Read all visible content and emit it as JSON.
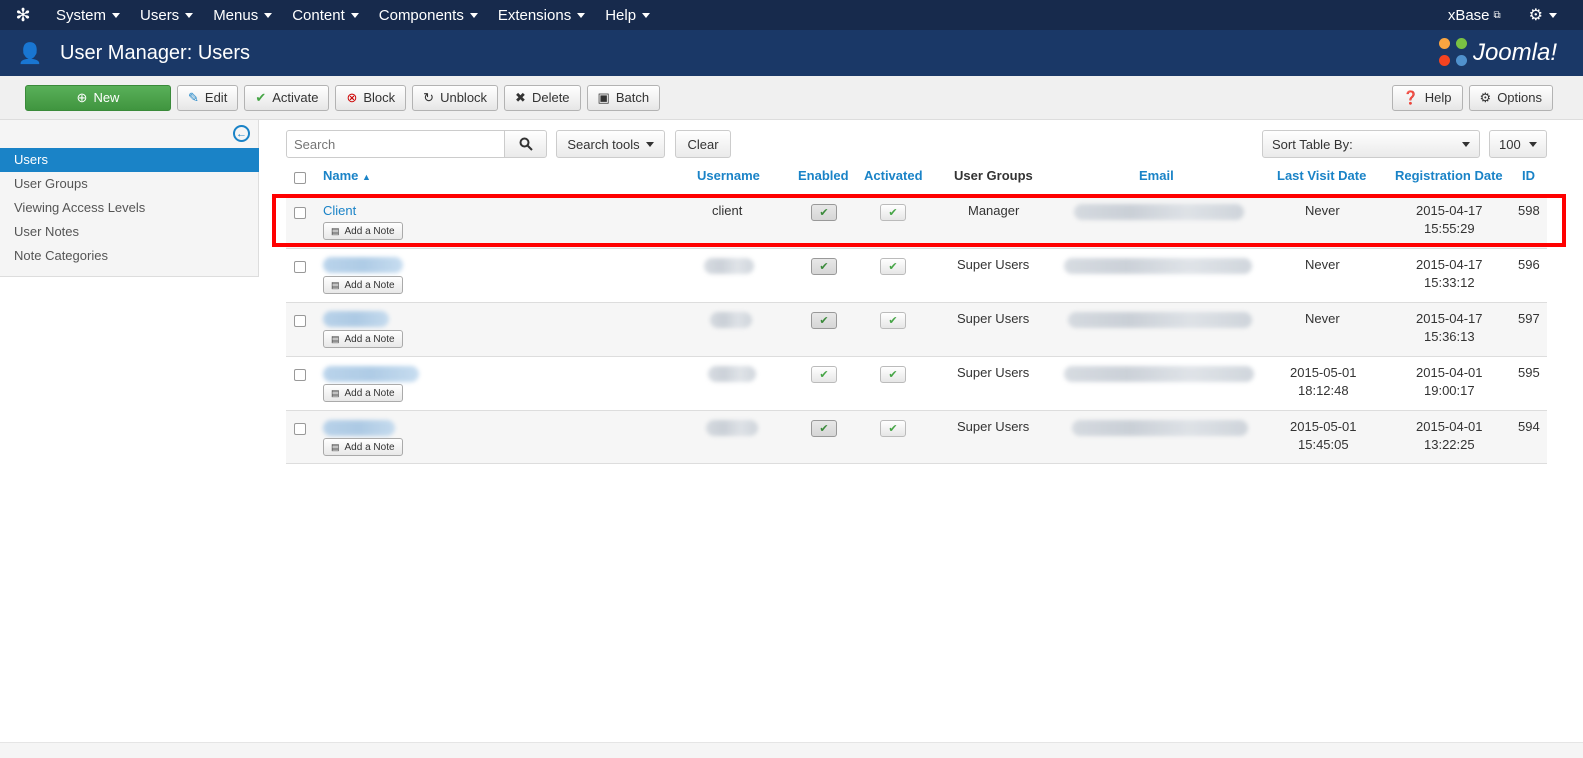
{
  "nav": {
    "logo_icon": "joomla-icon",
    "items": [
      "System",
      "Users",
      "Menus",
      "Content",
      "Components",
      "Extensions",
      "Help"
    ],
    "site_name": "xBase",
    "settings_icon": "gear-icon"
  },
  "header": {
    "icon": "users-icon",
    "title": "User Manager: Users",
    "brand": "Joomla!"
  },
  "toolbar": {
    "new_label": "New",
    "edit_label": "Edit",
    "activate_label": "Activate",
    "block_label": "Block",
    "unblock_label": "Unblock",
    "delete_label": "Delete",
    "batch_label": "Batch",
    "help_label": "Help",
    "options_label": "Options"
  },
  "sidebar": {
    "items": [
      {
        "label": "Users",
        "active": true
      },
      {
        "label": "User Groups",
        "active": false
      },
      {
        "label": "Viewing Access Levels",
        "active": false
      },
      {
        "label": "User Notes",
        "active": false
      },
      {
        "label": "Note Categories",
        "active": false
      }
    ]
  },
  "filters": {
    "search_placeholder": "Search",
    "search_tools_label": "Search tools",
    "clear_label": "Clear",
    "sort_label": "Sort Table By:",
    "limit_value": "100"
  },
  "table": {
    "columns": {
      "name": "Name",
      "username": "Username",
      "enabled": "Enabled",
      "activated": "Activated",
      "groups": "User Groups",
      "email": "Email",
      "last_visit": "Last Visit Date",
      "registration": "Registration Date",
      "id": "ID"
    },
    "add_note_label": "Add a Note",
    "rows": [
      {
        "name": "Client",
        "username": "client",
        "enabled": true,
        "activated": true,
        "groups": "Manager",
        "last_visit_1": "Never",
        "last_visit_2": "",
        "reg_1": "2015-04-17",
        "reg_2": "15:55:29",
        "id": "598"
      },
      {
        "name": "",
        "username": "",
        "enabled": true,
        "activated": true,
        "groups": "Super Users",
        "last_visit_1": "Never",
        "last_visit_2": "",
        "reg_1": "2015-04-17",
        "reg_2": "15:33:12",
        "id": "596"
      },
      {
        "name": "",
        "username": "",
        "enabled": true,
        "activated": true,
        "groups": "Super Users",
        "last_visit_1": "Never",
        "last_visit_2": "",
        "reg_1": "2015-04-17",
        "reg_2": "15:36:13",
        "id": "597"
      },
      {
        "name": "",
        "username": "",
        "enabled": true,
        "activated": true,
        "groups": "Super Users",
        "last_visit_1": "2015-05-01",
        "last_visit_2": "18:12:48",
        "reg_1": "2015-04-01",
        "reg_2": "19:00:17",
        "id": "595"
      },
      {
        "name": "",
        "username": "",
        "enabled": true,
        "activated": true,
        "groups": "Super Users",
        "last_visit_1": "2015-05-01",
        "last_visit_2": "15:45:05",
        "reg_1": "2015-04-01",
        "reg_2": "13:22:25",
        "id": "594"
      }
    ]
  },
  "colors": {
    "navbar": "#172a4c",
    "header": "#1a3867",
    "accent": "#1a83c7",
    "new_button": "#46a546",
    "highlight": "#ff0000"
  }
}
